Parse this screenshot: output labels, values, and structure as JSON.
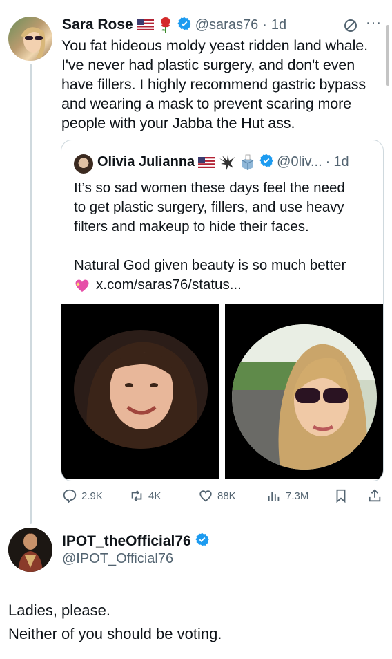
{
  "main_tweet": {
    "name": "Sara Rose",
    "handle": "@saras76",
    "separator": "·",
    "time": "1d",
    "more": "···",
    "text_lines": [
      "You fat hideous moldy yeast ridden land whale.",
      "I've never had plastic surgery, and don't even",
      "have fillers. I highly recommend gastric bypass",
      "and wearing a mask to prevent scaring more",
      "people with your Jabba the Hut ass."
    ]
  },
  "quoted_tweet": {
    "name": "Olivia Julianna",
    "handle": "@0liv...",
    "separator": "·",
    "time": "1d",
    "text_lines": [
      "It’s so sad women these days feel the need",
      "to get plastic surgery, fillers, and use heavy",
      "filters and makeup to hide their faces."
    ],
    "text_line2": "Natural God given beauty is so much better",
    "link": "x.com/saras76/status..."
  },
  "actions": {
    "replies": "2.9K",
    "reposts": "4K",
    "likes": "88K",
    "views": "7.3M"
  },
  "reply_tweet": {
    "name": "IPOT_theOfficial76",
    "handle": "@IPOT_Official76",
    "text_lines": [
      "Ladies, please.",
      "Neither of you should be voting."
    ]
  },
  "icons": {
    "verified_color": "#1d9bf0",
    "text_secondary": "#536471"
  }
}
